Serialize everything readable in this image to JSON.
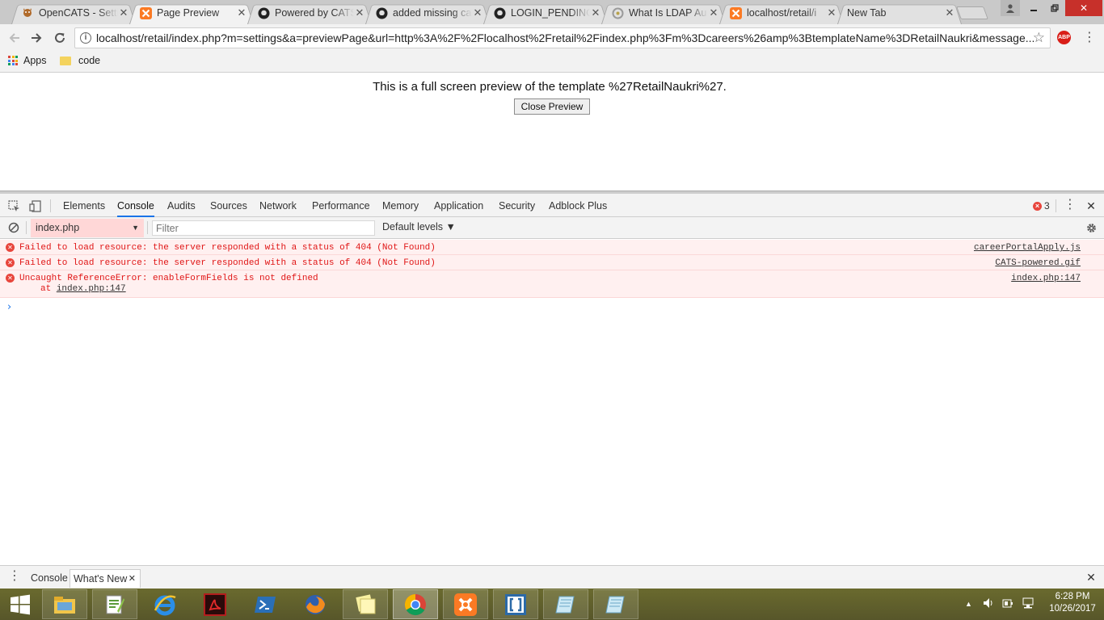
{
  "browser": {
    "tabs": [
      {
        "title": "OpenCATS - Settings",
        "icon": "opencats-icon",
        "active": false
      },
      {
        "title": "Page Preview",
        "icon": "xampp-icon",
        "active": true
      },
      {
        "title": "Powered by CATS",
        "icon": "github-icon",
        "active": false
      },
      {
        "title": "added missing ca",
        "icon": "github-icon",
        "active": false
      },
      {
        "title": "LOGIN_PENDING",
        "icon": "github-icon",
        "active": false
      },
      {
        "title": "What Is LDAP Au",
        "icon": "generic-page-icon",
        "active": false
      },
      {
        "title": "localhost/retail/i",
        "icon": "xampp-icon",
        "active": false
      },
      {
        "title": "New Tab",
        "icon": "",
        "active": false
      }
    ],
    "url": "localhost/retail/index.php?m=settings&a=previewPage&url=http%3A%2F%2Flocalhost%2Fretail%2Findex.php%3Fm%3Dcareers%26amp%3BtemplateName%3DRetailNaukri&message...",
    "abp_label": "ABP",
    "bookmarks": [
      {
        "label": "Apps"
      },
      {
        "label": "code"
      }
    ]
  },
  "page": {
    "message": "This is a full screen preview of the template %27RetailNaukri%27.",
    "close_button": "Close Preview"
  },
  "devtools": {
    "tabs": [
      "Elements",
      "Console",
      "Audits",
      "Sources",
      "Network",
      "Performance",
      "Memory",
      "Application",
      "Security",
      "Adblock Plus"
    ],
    "active_tab": "Console",
    "error_count": "3",
    "context": "index.php",
    "filter_placeholder": "Filter",
    "levels": "Default levels ▼",
    "messages": [
      {
        "text": "Failed to load resource: the server responded with a status of 404 (Not Found)",
        "source": "careerPortalApply.js"
      },
      {
        "text": "Failed to load resource: the server responded with a status of 404 (Not Found)",
        "source": "CATS-powered.gif"
      },
      {
        "text": "Uncaught ReferenceError: enableFormFields is not defined",
        "source": "index.php:147",
        "stack_prefix": "at",
        "stack_link": "index.php:147"
      }
    ],
    "drawer_tabs": [
      "Console",
      "What's New"
    ]
  },
  "taskbar": {
    "time": "6:28 PM",
    "date": "10/26/2017"
  },
  "colors": {
    "error_red": "#e01515",
    "error_bg": "#fff0f0",
    "accent_blue": "#1a73e8",
    "taskbar": "#5f5e2c"
  }
}
